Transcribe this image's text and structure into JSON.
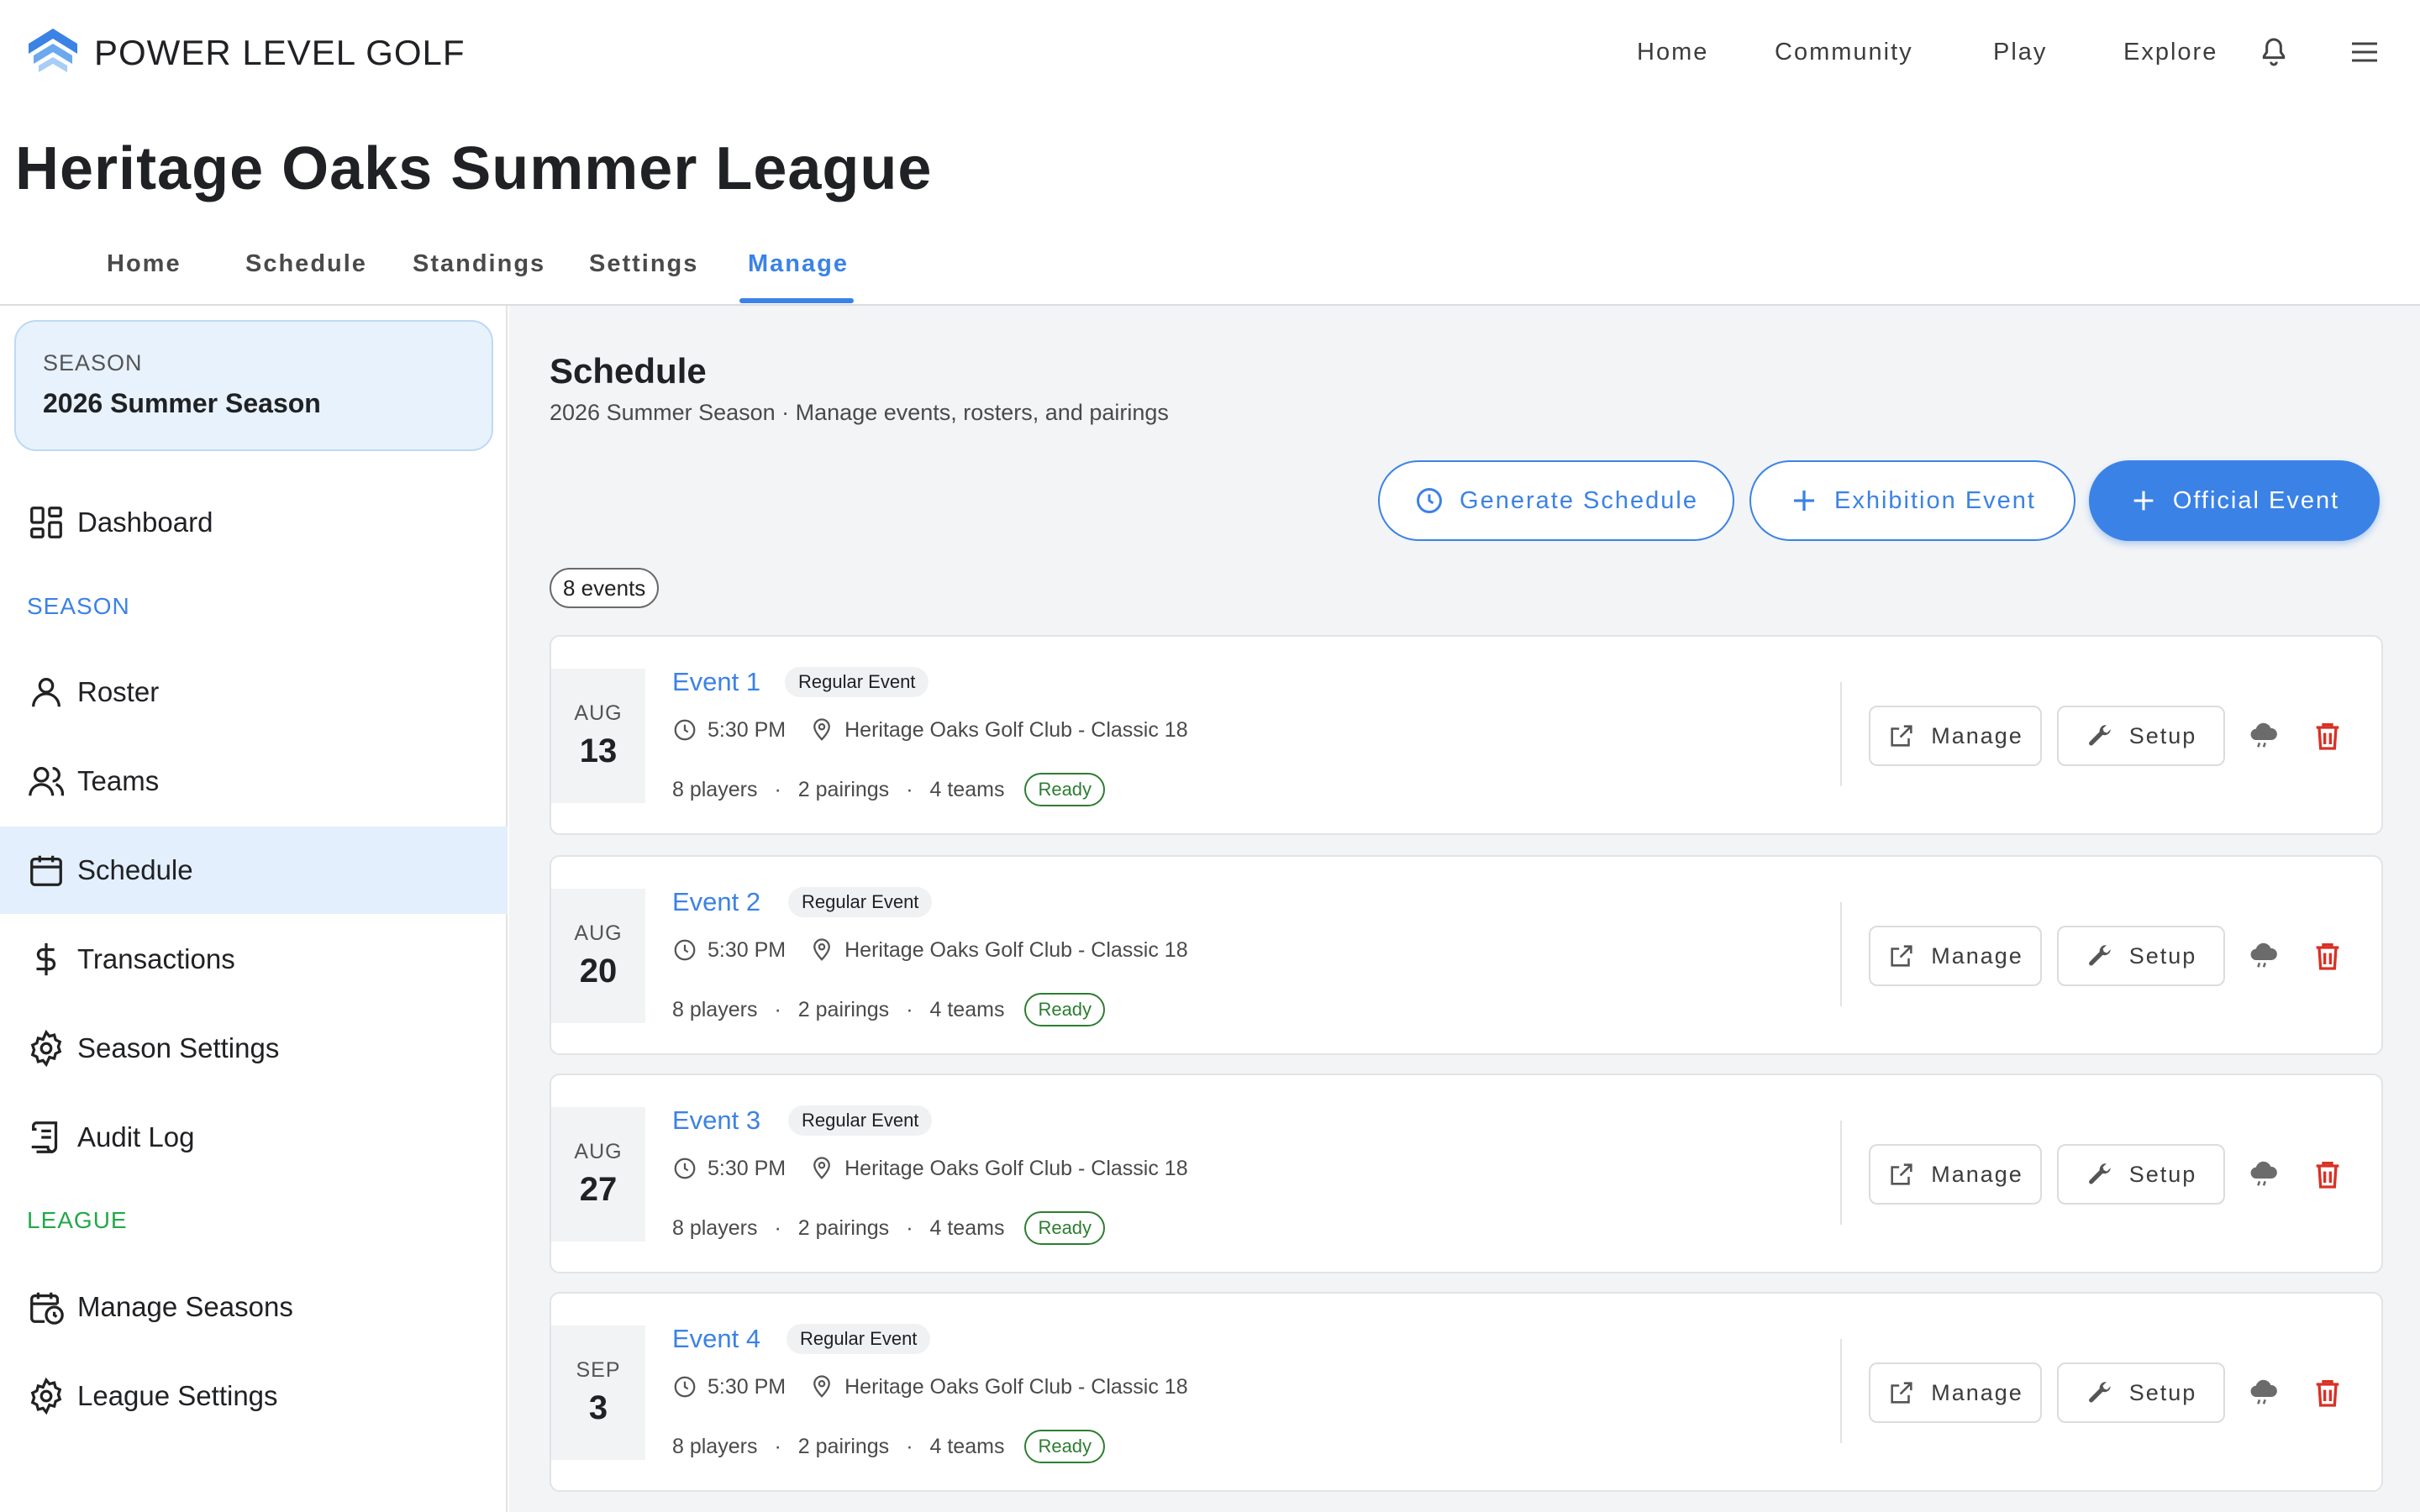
{
  "app": {
    "brand": "POWER LEVEL GOLF",
    "nav": [
      "Home",
      "Community",
      "Play",
      "Explore"
    ]
  },
  "page": {
    "title": "Heritage Oaks Summer League",
    "tabs": [
      "Home",
      "Schedule",
      "Standings",
      "Settings",
      "Manage"
    ],
    "active_tab": "Manage"
  },
  "sidebar": {
    "season_card": {
      "label": "SEASON",
      "value": "2026 Summer Season"
    },
    "dashboard": "Dashboard",
    "season_section": "SEASON",
    "season_items": [
      "Roster",
      "Teams",
      "Schedule",
      "Transactions",
      "Season Settings",
      "Audit Log"
    ],
    "league_section": "LEAGUE",
    "league_items": [
      "Manage Seasons",
      "League Settings"
    ],
    "active_item": "Schedule"
  },
  "main": {
    "title": "Schedule",
    "subtitle": "2026 Summer Season · Manage events, rosters, and pairings",
    "buttons": {
      "generate": "Generate Schedule",
      "exhibition": "Exhibition Event",
      "official": "Official Event"
    },
    "count": "8 events",
    "manage_label": "Manage",
    "setup_label": "Setup",
    "events": [
      {
        "name": "Event 1",
        "tag": "Regular Event",
        "month": "AUG",
        "day": "13",
        "time": "5:30 PM",
        "location": "Heritage Oaks Golf Club - Classic 18",
        "players": "8 players",
        "pairings": "2 pairings",
        "teams": "4 teams",
        "status": "Ready"
      },
      {
        "name": "Event 2",
        "tag": "Regular Event",
        "month": "AUG",
        "day": "20",
        "time": "5:30 PM",
        "location": "Heritage Oaks Golf Club - Classic 18",
        "players": "8 players",
        "pairings": "2 pairings",
        "teams": "4 teams",
        "status": "Ready"
      },
      {
        "name": "Event 3",
        "tag": "Regular Event",
        "month": "AUG",
        "day": "27",
        "time": "5:30 PM",
        "location": "Heritage Oaks Golf Club - Classic 18",
        "players": "8 players",
        "pairings": "2 pairings",
        "teams": "4 teams",
        "status": "Ready"
      },
      {
        "name": "Event 4",
        "tag": "Regular Event",
        "month": "SEP",
        "day": "3",
        "time": "5:30 PM",
        "location": "Heritage Oaks Golf Club - Classic 18",
        "players": "8 players",
        "pairings": "2 pairings",
        "teams": "4 teams",
        "status": "Ready"
      }
    ]
  },
  "colors": {
    "accent": "#3b82e6",
    "season_label": "#3b82e6",
    "league_label": "#22a94a",
    "ready": "#2e7d32",
    "delete": "#d93025"
  }
}
